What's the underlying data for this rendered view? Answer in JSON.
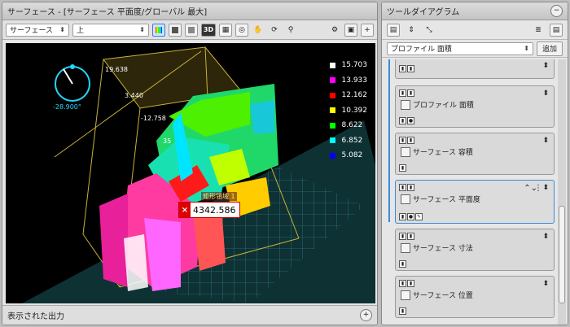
{
  "surface_window": {
    "title": "サーフェース - [サーフェース 平面度/グローバル 最大]",
    "source_select": "サーフェース",
    "view_select": "上",
    "three_d_label": "3D",
    "angle_readout": "-28.900°",
    "axis_labels": [
      "19.638",
      "3.440",
      "-12.758",
      "35"
    ],
    "legend": [
      {
        "value": "15.703",
        "color": "#ffffff"
      },
      {
        "value": "13.933",
        "color": "#ff00ff"
      },
      {
        "value": "12.162",
        "color": "#ff0000"
      },
      {
        "value": "10.392",
        "color": "#ffff00"
      },
      {
        "value": "8.622",
        "color": "#00ff00"
      },
      {
        "value": "6.852",
        "color": "#00ffff"
      },
      {
        "value": "5.082",
        "color": "#0000ff"
      }
    ],
    "region_label": "矩形領域 1",
    "measurement_value": "4342.586",
    "status_text": "表示された出力"
  },
  "tool_diagram": {
    "title": "ツールダイアグラム",
    "filter_select": "プロファイル 面積",
    "add_label": "追加",
    "items": [
      {
        "label": "プロファイル 面積",
        "icon": "profile-chart-icon",
        "selected": false
      },
      {
        "label": "サーフェース 容積",
        "icon": "surface-icon",
        "selected": false
      },
      {
        "label": "サーフェース 平面度",
        "icon": "surface-icon",
        "selected": true
      },
      {
        "label": "サーフェース 寸法",
        "icon": "surface-icon",
        "selected": false
      },
      {
        "label": "サーフェース 位置",
        "icon": "surface-icon",
        "selected": false
      }
    ]
  }
}
